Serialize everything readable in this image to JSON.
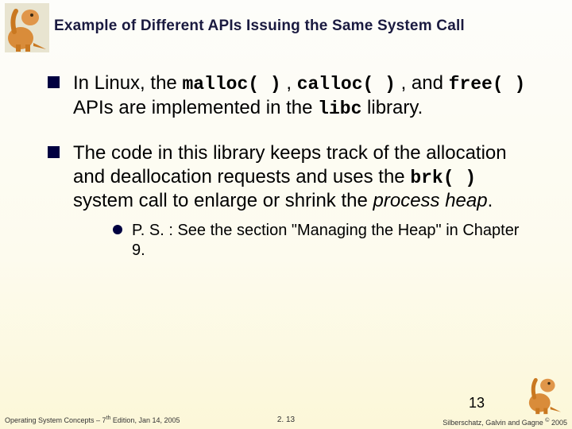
{
  "title": "Example of Different APIs Issuing the Same System Call",
  "bullets": [
    {
      "pre": "In Linux, the ",
      "c1": "malloc( )",
      "m1": " , ",
      "c2": "calloc( )",
      "m2": " , and ",
      "c3": "free( )",
      "m3": " APIs are implemented in the ",
      "c4": "libc",
      "m4": " library."
    },
    {
      "pre": "The code in this library keeps track of the allocation and deallocation requests and uses the ",
      "c1": "brk( )",
      "m1": " system call to enlarge or shrink the ",
      "ital": "process heap",
      "post": "."
    }
  ],
  "sub": {
    "text": "P. S. : See the section \"Managing the Heap\" in Chapter 9."
  },
  "footer": {
    "left_a": "Operating System Concepts – 7",
    "left_sup": "th",
    "left_b": " Edition, Jan 14, 2005",
    "center": "2. 13",
    "right_a": "Silberschatz, Galvin and Gagne ",
    "right_sup": "©",
    "right_b": " 2005",
    "pagenum": "13"
  }
}
